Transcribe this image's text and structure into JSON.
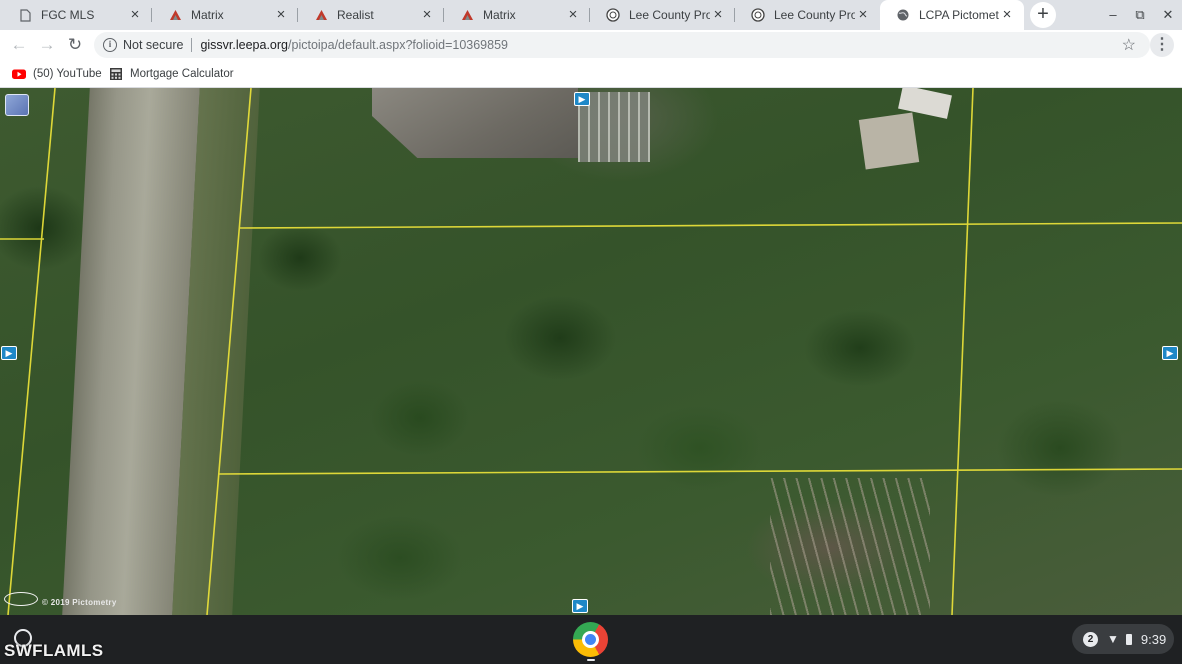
{
  "tabs": [
    {
      "title": "FGC MLS",
      "icon": "document-icon"
    },
    {
      "title": "Matrix",
      "icon": "matrix-icon"
    },
    {
      "title": "Realist",
      "icon": "realist-icon"
    },
    {
      "title": "Matrix",
      "icon": "matrix-icon"
    },
    {
      "title": "Lee County Propert",
      "icon": "county-seal-icon"
    },
    {
      "title": "Lee County Propert",
      "icon": "county-seal-icon"
    },
    {
      "title": "LCPA Pictometry V",
      "icon": "globe-icon"
    }
  ],
  "tab_close_glyph": "×",
  "new_tab_glyph": "+",
  "window_controls": {
    "minimize": "–",
    "maximize": "⧉",
    "close": "✕"
  },
  "toolbar": {
    "back_glyph": "←",
    "forward_glyph": "→",
    "reload_glyph": "↻",
    "security_label": "Not secure",
    "url_host": "gissvr.leepa.org",
    "url_path": "/pictoipa/default.aspx?folioid=10369859",
    "bookmark_star_glyph": "☆",
    "menu_glyph": "⋮"
  },
  "bookmarks": [
    {
      "label": "(50) YouTube",
      "icon": "youtube-icon"
    },
    {
      "label": "Mortgage Calculator",
      "icon": "calculator-icon"
    }
  ],
  "map": {
    "watermark": "© 2019 Pictometry",
    "marker_glyph": "▶"
  },
  "shelf": {
    "brand": "SWFLAMLS",
    "notification_count": "2",
    "wifi_glyph": "▼",
    "clock": "9:39"
  },
  "colors": {
    "tab_strip": "#dee1e6",
    "active_tab": "#ffffff",
    "parcel_line": "#f0e63a",
    "marker": "#1e88c7",
    "shelf": "#1f2123",
    "youtube_red": "#ff0000"
  }
}
